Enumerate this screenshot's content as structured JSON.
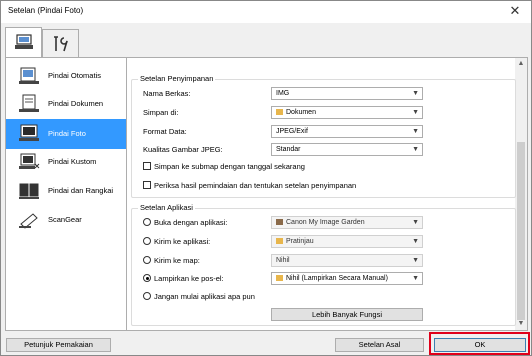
{
  "window": {
    "title": "Setelan (Pindai Foto)"
  },
  "tabs": [
    {
      "name": "scan-tab-icon"
    },
    {
      "name": "tools-tab-icon"
    }
  ],
  "sidebar": {
    "items": [
      {
        "label": "Pindai Otomatis"
      },
      {
        "label": "Pindai Dokumen"
      },
      {
        "label": "Pindai Foto"
      },
      {
        "label": "Pindai Kustom"
      },
      {
        "label": "Pindai dan Rangkai"
      },
      {
        "label": "ScanGear"
      }
    ]
  },
  "save": {
    "group_label": "Setelan Penyimpanan",
    "file_name_label": "Nama Berkas:",
    "file_name_value": "IMG",
    "save_in_label": "Simpan di:",
    "save_in_value": "Dokumen",
    "format_label": "Format Data:",
    "format_value": "JPEG/Exif",
    "quality_label": "Kualitas Gambar JPEG:",
    "quality_value": "Standar",
    "subfolder_label": "Simpan ke submap dengan tanggal sekarang",
    "check_label": "Periksa hasil pemindaian dan tentukan setelan penyimpanan"
  },
  "app": {
    "group_label": "Setelan Aplikasi",
    "open_label": "Buka dengan aplikasi:",
    "open_value": "Canon My Image Garden",
    "send_label": "Kirim ke aplikasi:",
    "send_value": "Pratinjau",
    "folder_label": "Kirim ke map:",
    "folder_value": "Nihil",
    "attach_label": "Lampirkan ke pos-el:",
    "attach_value": "Nihil (Lampirkan Secara Manual)",
    "none_label": "Jangan mulai aplikasi apa pun",
    "more_button": "Lebih Banyak Fungsi"
  },
  "footer": {
    "manual_button": "Petunjuk Pemakaian",
    "defaults_button": "Setelan Asal",
    "ok_button": "OK"
  },
  "colors": {
    "selection": "#3399ff",
    "highlight": "#e0001a"
  }
}
